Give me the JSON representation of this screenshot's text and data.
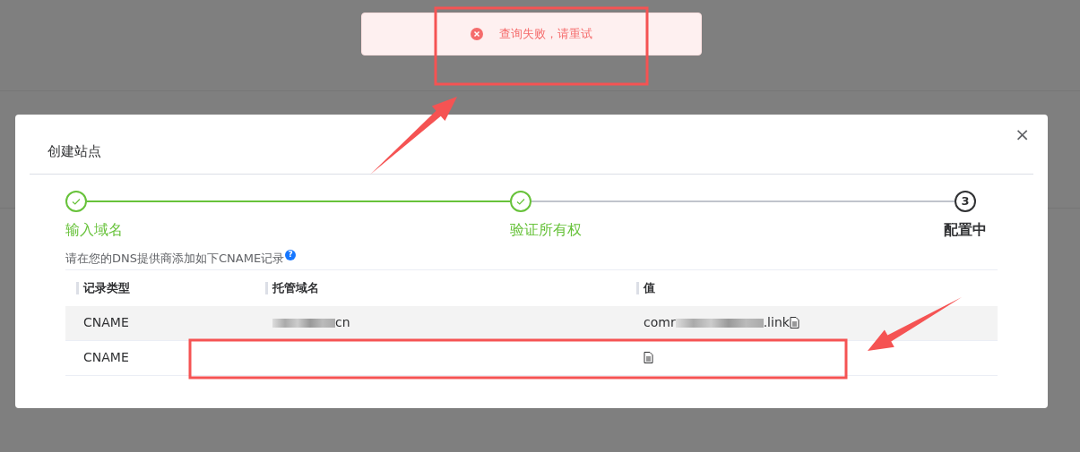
{
  "toast": {
    "kind": "error",
    "message": "查询失败，请重试"
  },
  "dialog": {
    "title": "创建站点",
    "close": "×",
    "steps": [
      {
        "label": "输入域名",
        "done": true
      },
      {
        "label": "验证所有权",
        "done": true
      },
      {
        "label": "配置中",
        "done": false,
        "number": "3"
      }
    ],
    "instruction": "请在您的DNS提供商添加如下CNAME记录",
    "help": "?",
    "table": {
      "columns": [
        "记录类型",
        "托管域名",
        "值"
      ],
      "rows": [
        {
          "hovered": true,
          "cells": [
            [
              {
                "kind": "text",
                "text": "CNAME"
              }
            ],
            [
              {
                "kind": "blur"
              },
              {
                "kind": "text",
                "text": "cn"
              }
            ],
            [
              {
                "kind": "text",
                "text": "comr"
              },
              {
                "kind": "blur"
              },
              {
                "kind": "text",
                "text": ".link"
              },
              {
                "kind": "copy"
              }
            ]
          ]
        },
        {
          "hovered": false,
          "cells": [
            [
              {
                "kind": "text",
                "text": "CNAME"
              }
            ],
            [],
            [
              {
                "kind": "copy"
              }
            ]
          ]
        }
      ]
    }
  },
  "annotations": [
    {
      "kind": "box"
    },
    {
      "kind": "arrow"
    },
    {
      "kind": "box"
    },
    {
      "kind": "arrow"
    }
  ]
}
